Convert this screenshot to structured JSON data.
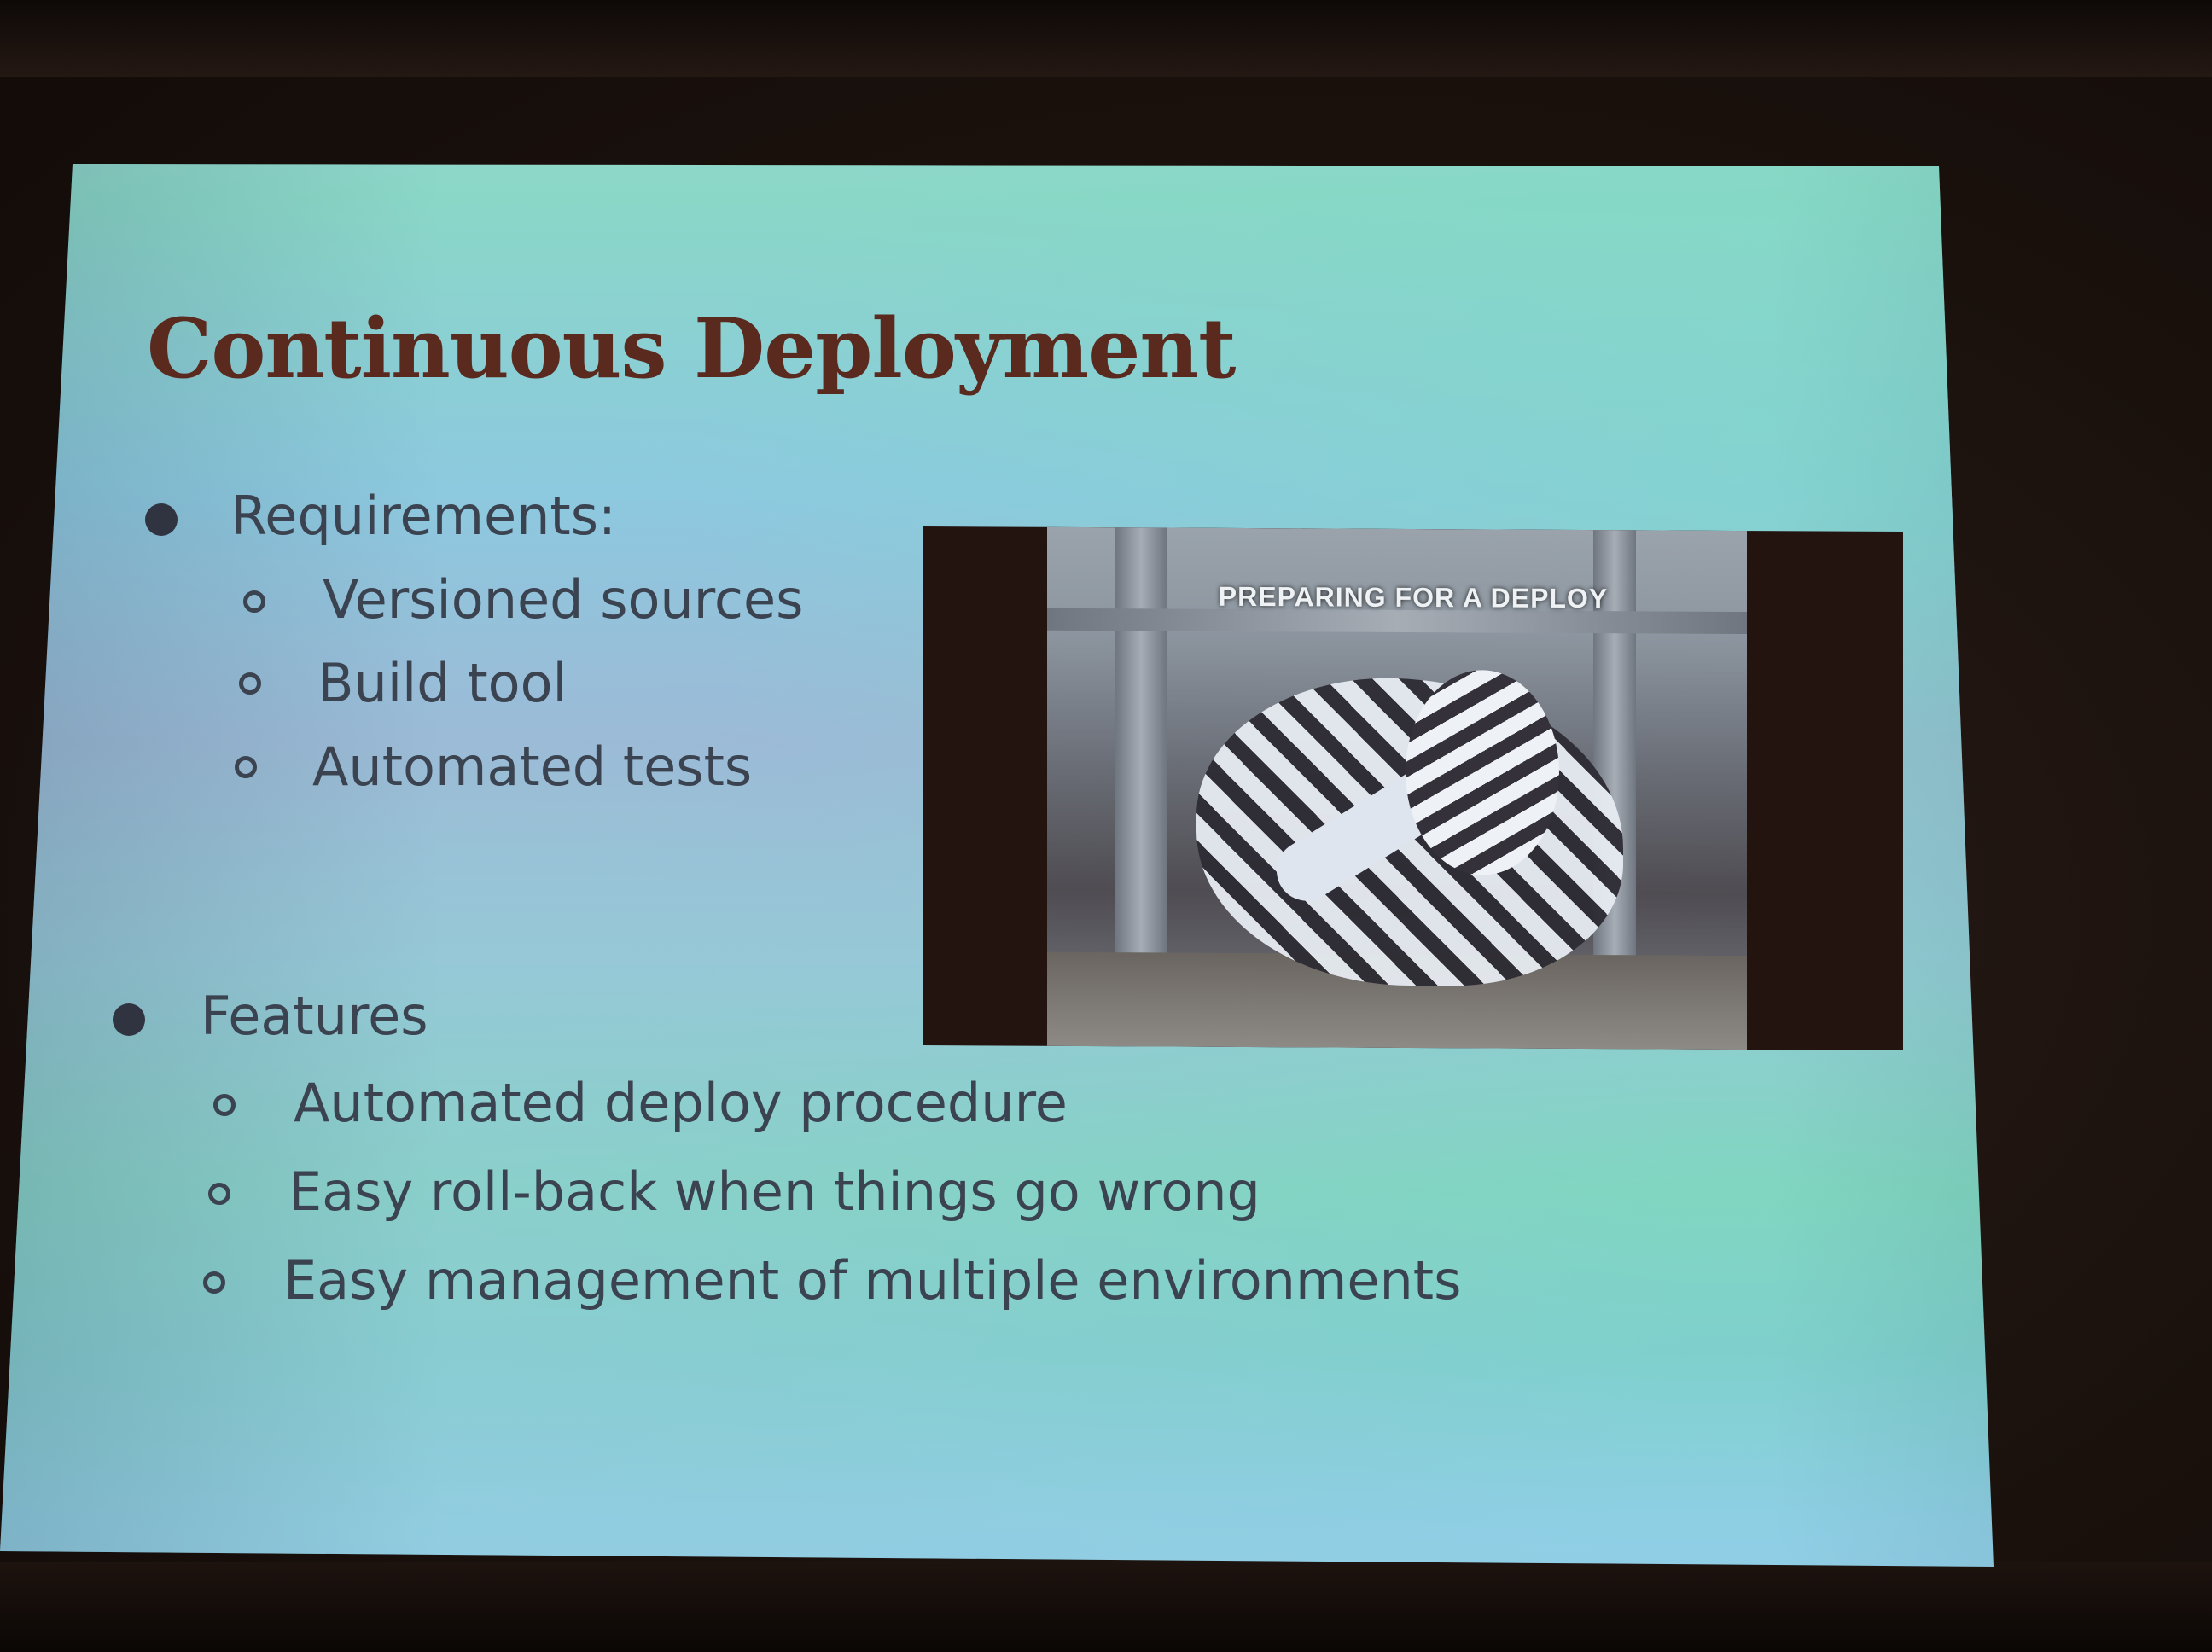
{
  "slide": {
    "title": "Continuous Deployment",
    "sections": [
      {
        "label": "Requirements:",
        "items": [
          "Versioned sources",
          "Build tool",
          "Automated tests"
        ]
      },
      {
        "label": "Features",
        "items": [
          "Automated deploy procedure",
          "Easy roll-back when things go wrong",
          "Easy management of multiple environments"
        ]
      }
    ],
    "image": {
      "caption": "PREPARING FOR A DEPLOY"
    }
  },
  "colors": {
    "title": "#5a2a1f",
    "body_text": "#3b4350",
    "background_top": "#8ad7c7",
    "background_mid": "#9db7d6"
  }
}
